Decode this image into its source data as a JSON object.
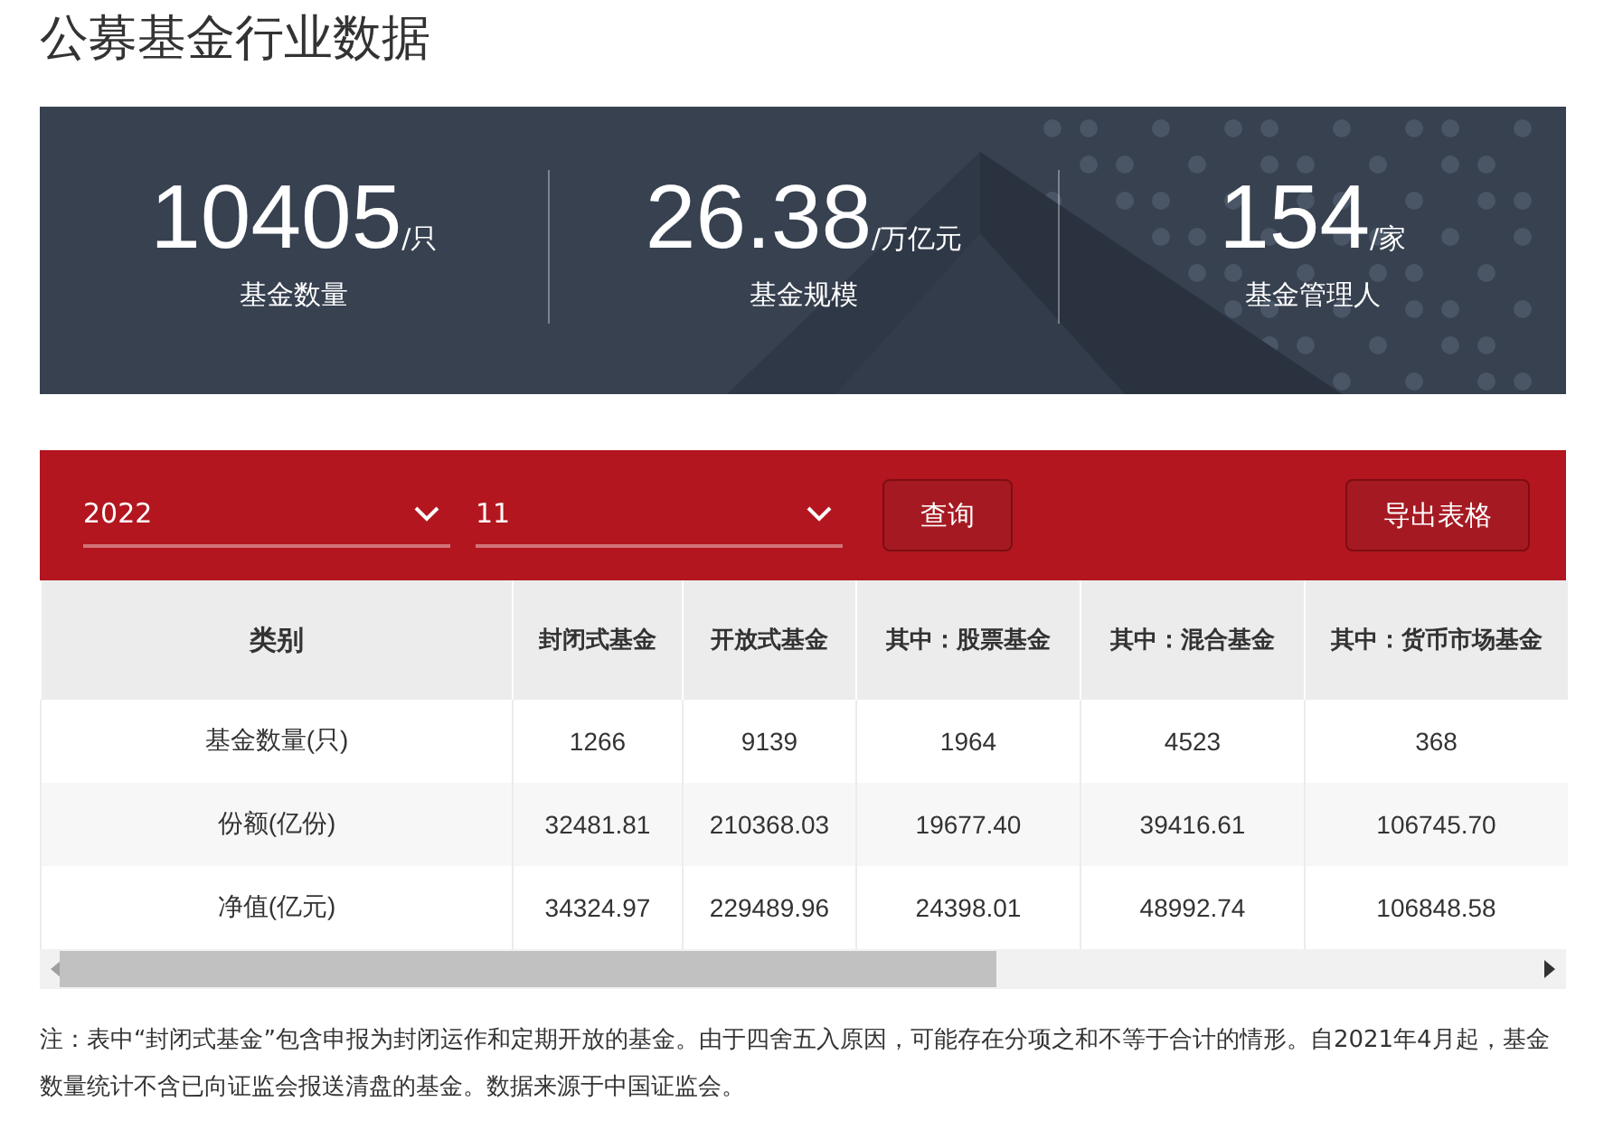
{
  "title": "公募基金行业数据",
  "stats": [
    {
      "value": "10405",
      "unit": "/只",
      "label": "基金数量"
    },
    {
      "value": "26.38",
      "unit": "/万亿元",
      "label": "基金规模"
    },
    {
      "value": "154",
      "unit": "/家",
      "label": "基金管理人"
    }
  ],
  "filters": {
    "year": "2022",
    "month": "11",
    "query_button": "查询",
    "export_button": "导出表格"
  },
  "table": {
    "columns": [
      "类别",
      "封闭式基金",
      "开放式基金",
      "其中：股票基金",
      "其中：混合基金",
      "其中：货币市场基金"
    ],
    "rows": [
      [
        "基金数量(只)",
        "1266",
        "9139",
        "1964",
        "4523",
        "368"
      ],
      [
        "份额(亿份)",
        "32481.81",
        "210368.03",
        "19677.40",
        "39416.61",
        "106745.70"
      ],
      [
        "净值(亿元)",
        "34324.97",
        "229489.96",
        "24398.01",
        "48992.74",
        "106848.58"
      ]
    ]
  },
  "note": "注：表中“封闭式基金”包含申报为封闭运作和定期开放的基金。由于四舍五入原因，可能存在分项之和不等于合计的情形。自2021年4月起，基金数量统计不含已向证监会报送清盘的基金。数据来源于中国证监会。"
}
